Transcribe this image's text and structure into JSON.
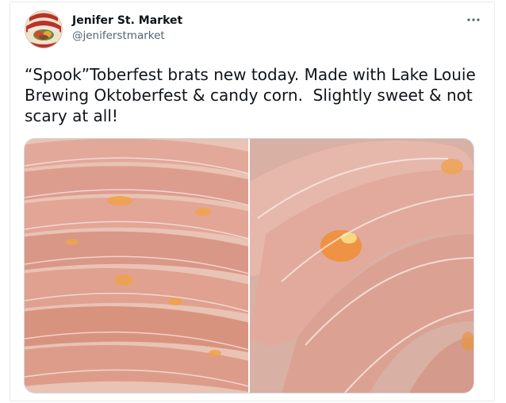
{
  "tweet": {
    "display_name": "Jenifer St. Market",
    "handle": "@jeniferstmarket",
    "text": "“Spook”Toberfest brats new today. Made with Lake Louie Brewing Oktoberfest & candy corn.  Slightly sweet & not scary at all!",
    "more_icon": "more-horizontal-icon"
  },
  "avatar": {
    "logo_text_top": "JENIFER ST.",
    "logo_text_bottom": "MARKET"
  },
  "media": {
    "photos": [
      {
        "description_icon": "sausage-photo"
      },
      {
        "description_icon": "sausage-closeup-photo"
      }
    ]
  },
  "colors": {
    "text_primary": "#0f1419",
    "text_secondary": "#536471",
    "border": "#cfd9de"
  }
}
